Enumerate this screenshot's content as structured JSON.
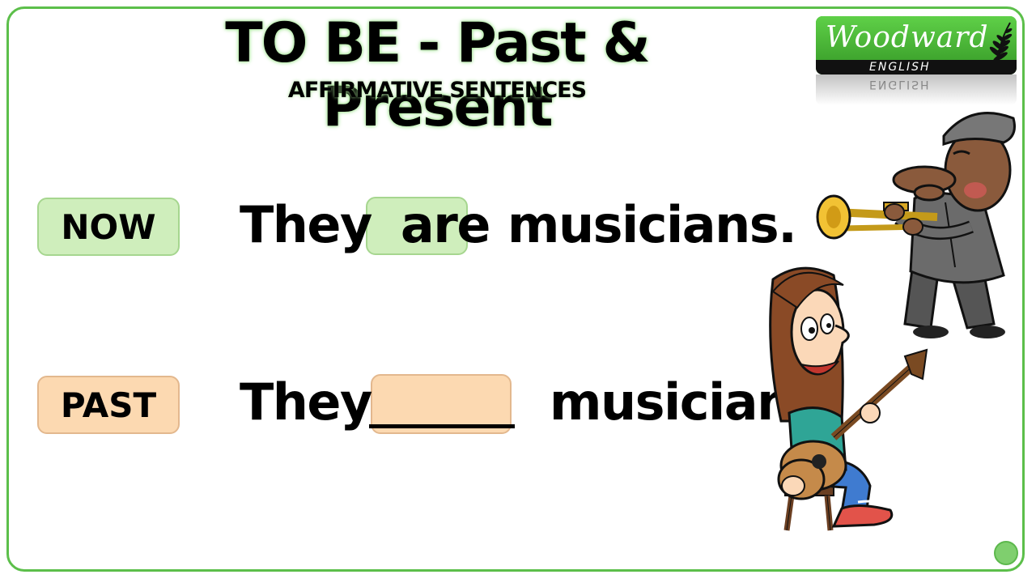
{
  "header": {
    "title": "TO BE - Past & Present",
    "subtitle": "AFFIRMATIVE SENTENCES"
  },
  "logo": {
    "name": "Woodward",
    "tagline": "ENGLISH",
    "reflection": "ENGLISH"
  },
  "rows": [
    {
      "label": "NOW",
      "subject": "They",
      "verb": "are",
      "complement": "musicians."
    },
    {
      "label": "PAST",
      "subject": "They",
      "verb": "",
      "complement": "musicians."
    }
  ],
  "colors": {
    "frame": "#5cbf4a",
    "now": "#cfeebc",
    "past": "#fcd9b1",
    "brand": "#4cbe39"
  },
  "icons": [
    "trumpet-player-illustration",
    "guitar-player-illustration",
    "fern-icon",
    "badge-icon"
  ]
}
